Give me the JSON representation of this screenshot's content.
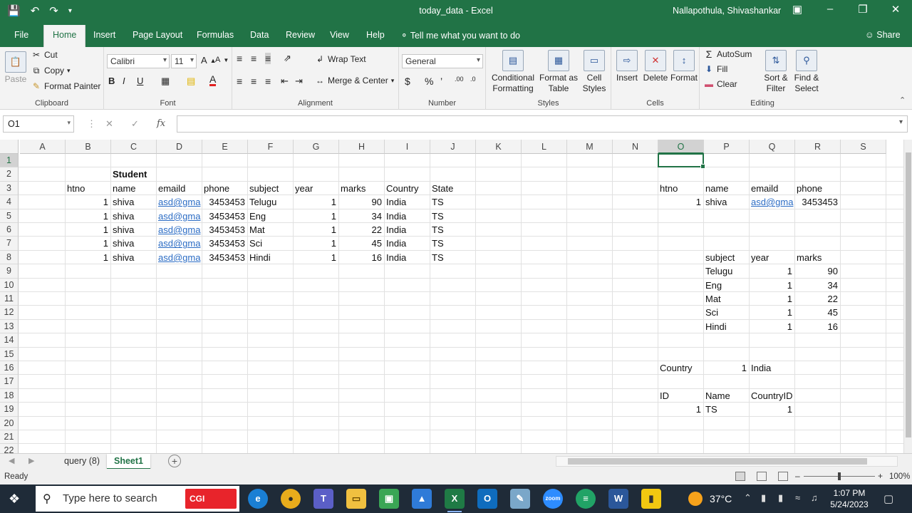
{
  "titlebar": {
    "doc_title": "today_data  -  Excel",
    "user": "Nallapothula, Shivashankar"
  },
  "tabs": [
    "File",
    "Home",
    "Insert",
    "Page Layout",
    "Formulas",
    "Data",
    "Review",
    "View",
    "Help"
  ],
  "tell_me": "Tell me what you want to do",
  "share": "Share",
  "ribbon": {
    "clipboard": {
      "paste": "Paste",
      "cut": "Cut",
      "copy": "Copy",
      "format_painter": "Format Painter",
      "label": "Clipboard"
    },
    "font": {
      "name": "Calibri",
      "size": "11",
      "label": "Font"
    },
    "alignment": {
      "wrap": "Wrap Text",
      "merge": "Merge & Center",
      "label": "Alignment"
    },
    "number": {
      "format": "General",
      "label": "Number"
    },
    "styles": {
      "cond": [
        "Conditional",
        "Formatting"
      ],
      "table": [
        "Format as",
        "Table"
      ],
      "cell": [
        "Cell",
        "Styles"
      ],
      "label": "Styles"
    },
    "cells": {
      "insert": "Insert",
      "delete": "Delete",
      "format": "Format",
      "label": "Cells"
    },
    "editing": {
      "autosum": "AutoSum",
      "fill": "Fill",
      "clear": "Clear",
      "sort": [
        "Sort &",
        "Filter"
      ],
      "find": [
        "Find &",
        "Select"
      ],
      "label": "Editing"
    }
  },
  "formula_bar": {
    "name_box": "O1",
    "formula": ""
  },
  "columns": [
    "A",
    "B",
    "C",
    "D",
    "E",
    "F",
    "G",
    "H",
    "I",
    "J",
    "K",
    "L",
    "M",
    "N",
    "O",
    "P",
    "Q",
    "R",
    "S"
  ],
  "rows": [
    "1",
    "2",
    "3",
    "4",
    "5",
    "6",
    "7",
    "8",
    "9",
    "10",
    "11",
    "12",
    "13",
    "14",
    "15",
    "16",
    "17",
    "18",
    "19",
    "20",
    "21",
    "22"
  ],
  "cells": [
    {
      "col": "C",
      "row": 2,
      "v": "Student",
      "bold": true
    },
    {
      "col": "B",
      "row": 3,
      "v": "htno"
    },
    {
      "col": "C",
      "row": 3,
      "v": "name"
    },
    {
      "col": "D",
      "row": 3,
      "v": "emaild"
    },
    {
      "col": "E",
      "row": 3,
      "v": "phone"
    },
    {
      "col": "F",
      "row": 3,
      "v": "subject"
    },
    {
      "col": "G",
      "row": 3,
      "v": "year"
    },
    {
      "col": "H",
      "row": 3,
      "v": "marks"
    },
    {
      "col": "I",
      "row": 3,
      "v": "Country"
    },
    {
      "col": "J",
      "row": 3,
      "v": "State"
    },
    {
      "col": "B",
      "row": 4,
      "v": "1",
      "num": true
    },
    {
      "col": "C",
      "row": 4,
      "v": "shiva"
    },
    {
      "col": "D",
      "row": 4,
      "v": "asd@gma",
      "link": true
    },
    {
      "col": "E",
      "row": 4,
      "v": "3453453",
      "num": true
    },
    {
      "col": "F",
      "row": 4,
      "v": "Telugu"
    },
    {
      "col": "G",
      "row": 4,
      "v": "1",
      "num": true
    },
    {
      "col": "H",
      "row": 4,
      "v": "90",
      "num": true
    },
    {
      "col": "I",
      "row": 4,
      "v": "India"
    },
    {
      "col": "J",
      "row": 4,
      "v": "TS"
    },
    {
      "col": "B",
      "row": 5,
      "v": "1",
      "num": true
    },
    {
      "col": "C",
      "row": 5,
      "v": "shiva"
    },
    {
      "col": "D",
      "row": 5,
      "v": "asd@gma",
      "link": true
    },
    {
      "col": "E",
      "row": 5,
      "v": "3453453",
      "num": true
    },
    {
      "col": "F",
      "row": 5,
      "v": "Eng"
    },
    {
      "col": "G",
      "row": 5,
      "v": "1",
      "num": true
    },
    {
      "col": "H",
      "row": 5,
      "v": "34",
      "num": true
    },
    {
      "col": "I",
      "row": 5,
      "v": "India"
    },
    {
      "col": "J",
      "row": 5,
      "v": "TS"
    },
    {
      "col": "B",
      "row": 6,
      "v": "1",
      "num": true
    },
    {
      "col": "C",
      "row": 6,
      "v": "shiva"
    },
    {
      "col": "D",
      "row": 6,
      "v": "asd@gma",
      "link": true
    },
    {
      "col": "E",
      "row": 6,
      "v": "3453453",
      "num": true
    },
    {
      "col": "F",
      "row": 6,
      "v": "Mat"
    },
    {
      "col": "G",
      "row": 6,
      "v": "1",
      "num": true
    },
    {
      "col": "H",
      "row": 6,
      "v": "22",
      "num": true
    },
    {
      "col": "I",
      "row": 6,
      "v": "India"
    },
    {
      "col": "J",
      "row": 6,
      "v": "TS"
    },
    {
      "col": "B",
      "row": 7,
      "v": "1",
      "num": true
    },
    {
      "col": "C",
      "row": 7,
      "v": "shiva"
    },
    {
      "col": "D",
      "row": 7,
      "v": "asd@gma",
      "link": true
    },
    {
      "col": "E",
      "row": 7,
      "v": "3453453",
      "num": true
    },
    {
      "col": "F",
      "row": 7,
      "v": "Sci"
    },
    {
      "col": "G",
      "row": 7,
      "v": "1",
      "num": true
    },
    {
      "col": "H",
      "row": 7,
      "v": "45",
      "num": true
    },
    {
      "col": "I",
      "row": 7,
      "v": "India"
    },
    {
      "col": "J",
      "row": 7,
      "v": "TS"
    },
    {
      "col": "B",
      "row": 8,
      "v": "1",
      "num": true
    },
    {
      "col": "C",
      "row": 8,
      "v": "shiva"
    },
    {
      "col": "D",
      "row": 8,
      "v": "asd@gma",
      "link": true
    },
    {
      "col": "E",
      "row": 8,
      "v": "3453453",
      "num": true
    },
    {
      "col": "F",
      "row": 8,
      "v": "Hindi"
    },
    {
      "col": "G",
      "row": 8,
      "v": "1",
      "num": true
    },
    {
      "col": "H",
      "row": 8,
      "v": "16",
      "num": true
    },
    {
      "col": "I",
      "row": 8,
      "v": "India"
    },
    {
      "col": "J",
      "row": 8,
      "v": "TS"
    },
    {
      "col": "O",
      "row": 3,
      "v": "htno"
    },
    {
      "col": "P",
      "row": 3,
      "v": "name"
    },
    {
      "col": "Q",
      "row": 3,
      "v": "emaild"
    },
    {
      "col": "R",
      "row": 3,
      "v": "phone"
    },
    {
      "col": "O",
      "row": 4,
      "v": "1",
      "num": true
    },
    {
      "col": "P",
      "row": 4,
      "v": "shiva"
    },
    {
      "col": "Q",
      "row": 4,
      "v": "asd@gma",
      "link": true
    },
    {
      "col": "R",
      "row": 4,
      "v": "3453453",
      "num": true
    },
    {
      "col": "P",
      "row": 8,
      "v": "subject"
    },
    {
      "col": "Q",
      "row": 8,
      "v": "year"
    },
    {
      "col": "R",
      "row": 8,
      "v": "marks"
    },
    {
      "col": "P",
      "row": 9,
      "v": "Telugu"
    },
    {
      "col": "Q",
      "row": 9,
      "v": "1",
      "num": true
    },
    {
      "col": "R",
      "row": 9,
      "v": "90",
      "num": true
    },
    {
      "col": "P",
      "row": 10,
      "v": "Eng"
    },
    {
      "col": "Q",
      "row": 10,
      "v": "1",
      "num": true
    },
    {
      "col": "R",
      "row": 10,
      "v": "34",
      "num": true
    },
    {
      "col": "P",
      "row": 11,
      "v": "Mat"
    },
    {
      "col": "Q",
      "row": 11,
      "v": "1",
      "num": true
    },
    {
      "col": "R",
      "row": 11,
      "v": "22",
      "num": true
    },
    {
      "col": "P",
      "row": 12,
      "v": "Sci"
    },
    {
      "col": "Q",
      "row": 12,
      "v": "1",
      "num": true
    },
    {
      "col": "R",
      "row": 12,
      "v": "45",
      "num": true
    },
    {
      "col": "P",
      "row": 13,
      "v": "Hindi"
    },
    {
      "col": "Q",
      "row": 13,
      "v": "1",
      "num": true
    },
    {
      "col": "R",
      "row": 13,
      "v": "16",
      "num": true
    },
    {
      "col": "O",
      "row": 16,
      "v": "Country"
    },
    {
      "col": "P",
      "row": 16,
      "v": "1",
      "num": true
    },
    {
      "col": "Q",
      "row": 16,
      "v": "India"
    },
    {
      "col": "O",
      "row": 18,
      "v": "ID"
    },
    {
      "col": "P",
      "row": 18,
      "v": "Name"
    },
    {
      "col": "Q",
      "row": 18,
      "v": "CountryID"
    },
    {
      "col": "O",
      "row": 19,
      "v": "1",
      "num": true
    },
    {
      "col": "P",
      "row": 19,
      "v": "TS"
    },
    {
      "col": "Q",
      "row": 19,
      "v": "1",
      "num": true
    }
  ],
  "sheets": [
    {
      "name": "query (8)",
      "active": false
    },
    {
      "name": "Sheet1",
      "active": true
    }
  ],
  "status": {
    "ready": "Ready",
    "zoom": "100%"
  },
  "taskbar": {
    "search_placeholder": "Type here to search",
    "cgi": "CGI",
    "temperature": "37°C",
    "time": "1:07 PM",
    "date": "5/24/2023"
  },
  "colors": {
    "accent": "#217346",
    "link": "#2b6cc4"
  }
}
